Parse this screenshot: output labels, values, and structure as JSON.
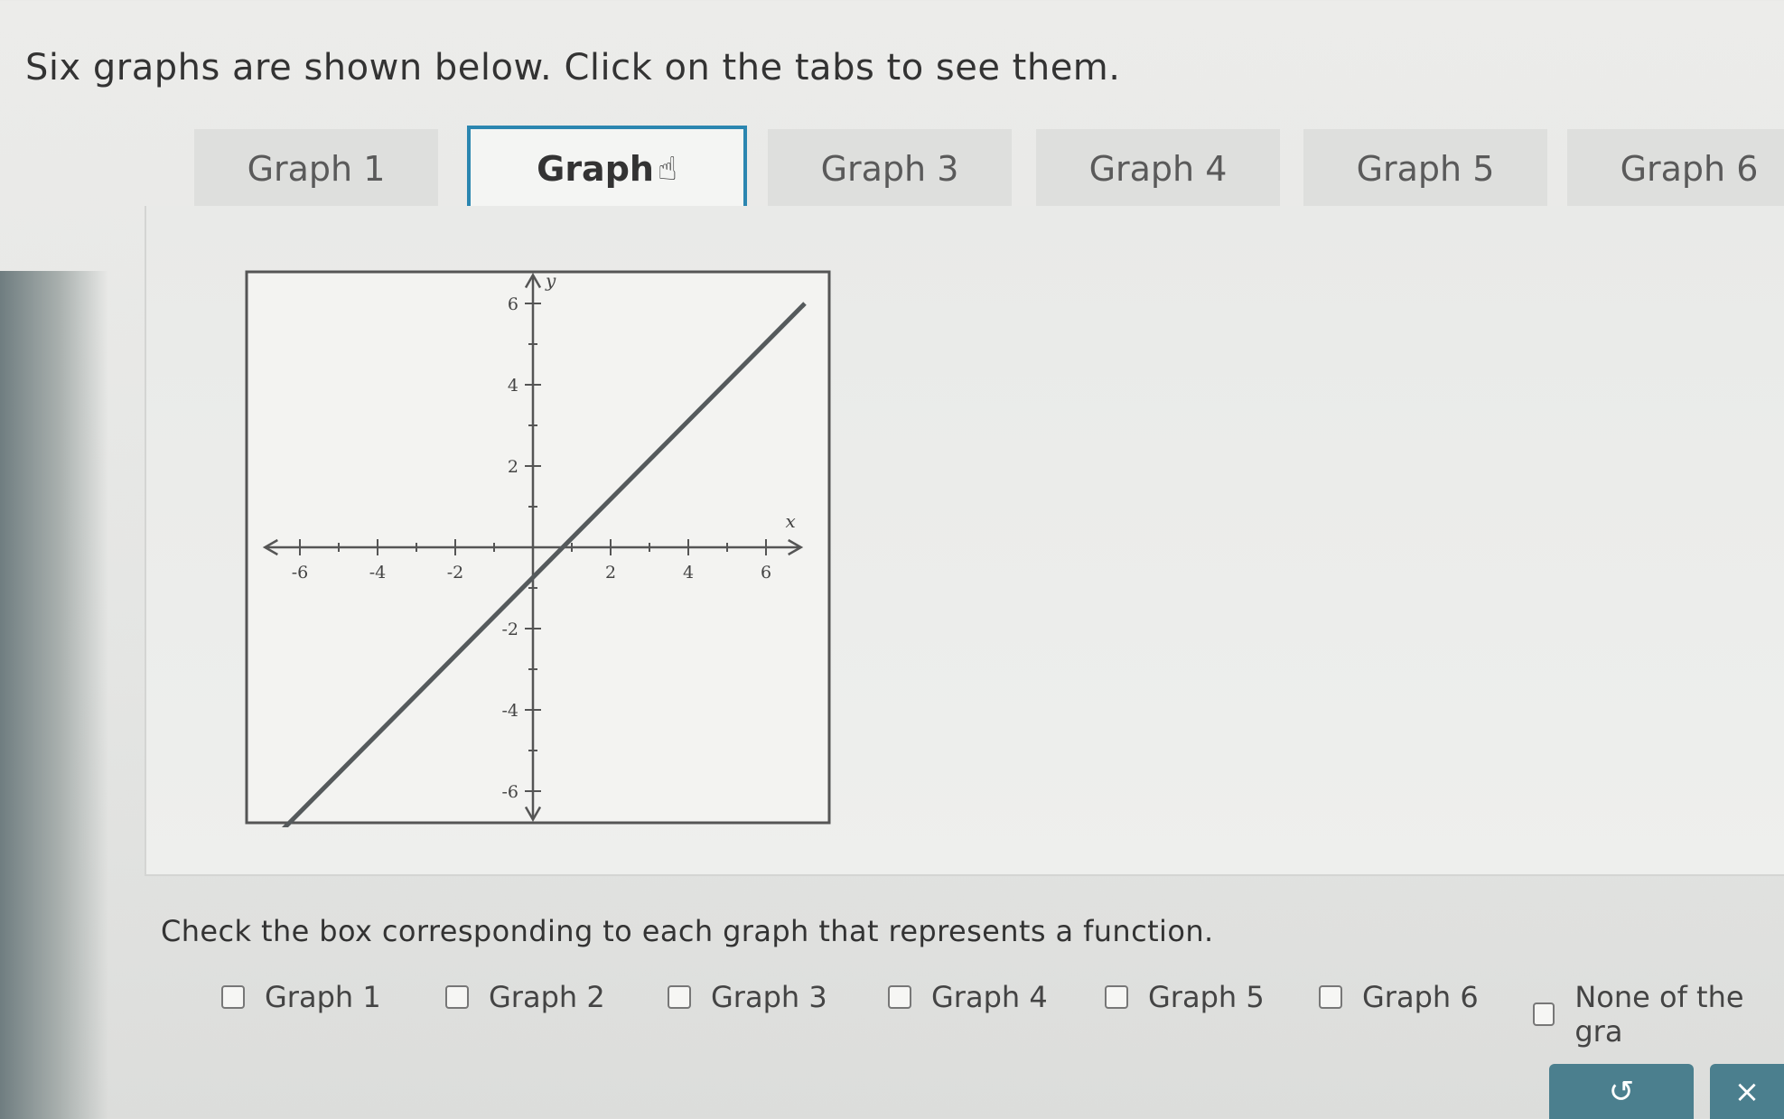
{
  "instructions": "Six graphs are shown below. Click on the tabs to see them.",
  "tabs": [
    {
      "label": "Graph 1"
    },
    {
      "label": "Graph"
    },
    {
      "label": "Graph 3"
    },
    {
      "label": "Graph 4"
    },
    {
      "label": "Graph 5"
    },
    {
      "label": "Graph 6"
    }
  ],
  "active_tab": 1,
  "graph": {
    "x_axis_label": "x",
    "y_axis_label": "y",
    "x_ticks": [
      "-6",
      "-4",
      "-2",
      "2",
      "4",
      "6"
    ],
    "y_ticks": [
      "6",
      "4",
      "2",
      "-2",
      "-4",
      "-6"
    ],
    "line_color": "#555a5c"
  },
  "chart_data": {
    "type": "line",
    "x": [
      -6.5,
      7
    ],
    "y": [
      -7,
      6
    ],
    "xlabel": "x",
    "ylabel": "y",
    "xlim": [
      -7,
      7
    ],
    "ylim": [
      -7,
      7
    ],
    "grid": false
  },
  "question": "Check the box corresponding to each graph that represents a function.",
  "options": [
    {
      "label": "Graph 1",
      "checked": false
    },
    {
      "label": "Graph 2",
      "checked": false
    },
    {
      "label": "Graph 3",
      "checked": false
    },
    {
      "label": "Graph 4",
      "checked": false
    },
    {
      "label": "Graph 5",
      "checked": false
    },
    {
      "label": "Graph 6",
      "checked": false
    },
    {
      "label": "None of the gra",
      "checked": false
    }
  ],
  "buttons": {
    "undo_icon": "undo-icon",
    "close_icon": "close-icon",
    "undo_glyph": "↺",
    "close_glyph": "×"
  },
  "colors": {
    "accent": "#2b86b0",
    "button": "#4b7f8e"
  }
}
